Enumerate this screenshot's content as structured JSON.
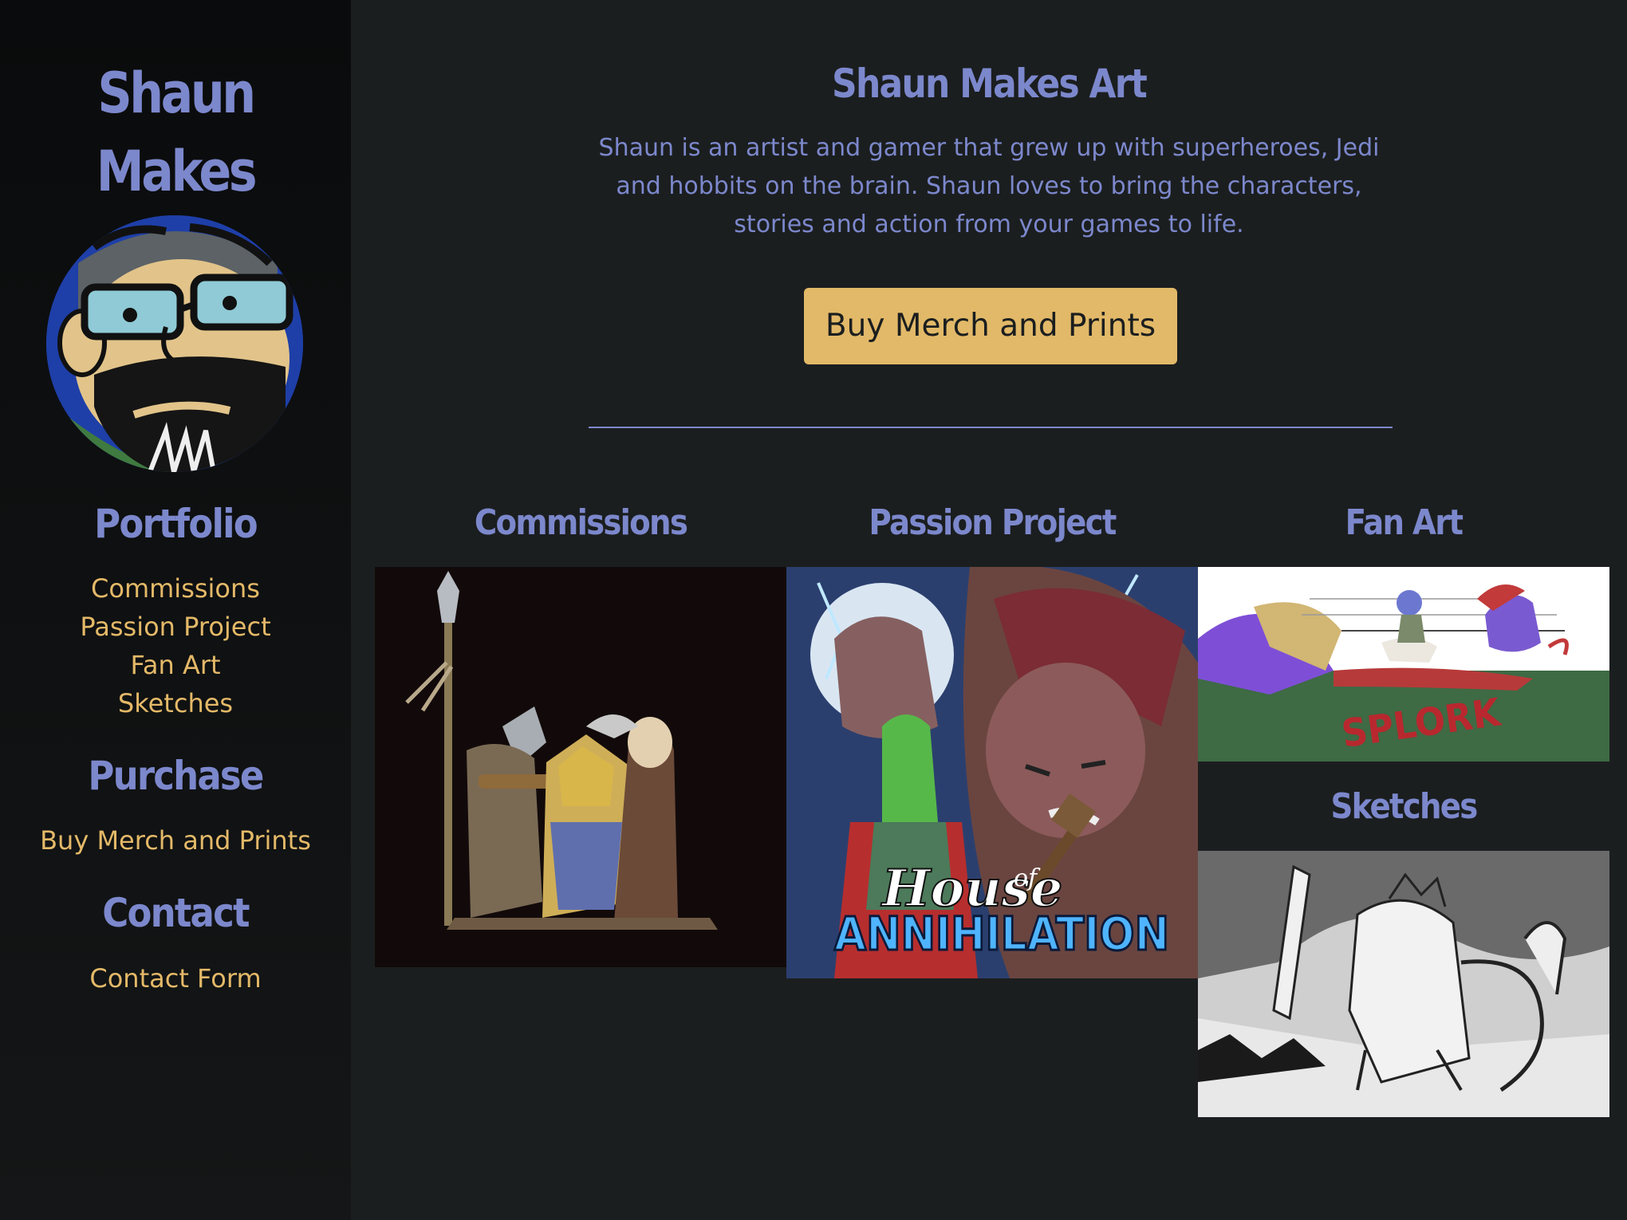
{
  "sidebar": {
    "brand_line1": "Shaun",
    "brand_line2": "Makes",
    "portfolio": {
      "heading": "Portfolio",
      "items": [
        "Commissions",
        "Passion Project",
        "Fan Art",
        "Sketches"
      ]
    },
    "purchase": {
      "heading": "Purchase",
      "items": [
        "Buy Merch and Prints"
      ]
    },
    "contact": {
      "heading": "Contact",
      "items": [
        "Contact Form"
      ]
    }
  },
  "main": {
    "title": "Shaun Makes Art",
    "intro": "Shaun is an artist and gamer that grew up with superheroes, Jedi and hobbits on the brain. Shaun loves to bring the characters, stories and action from your games to life.",
    "cta_label": "Buy Merch and Prints",
    "gallery": {
      "commissions_title": "Commissions",
      "passion_title": "Passion Project",
      "fanart_title": "Fan Art",
      "sketches_title": "Sketches",
      "passion_logo_line1": "House",
      "passion_logo_of": "of",
      "passion_logo_line2": "ANNIHILATION",
      "fanart_sfx": "SPLORK"
    }
  },
  "colors": {
    "accent_blue": "#7c88cc",
    "accent_gold": "#e2b968",
    "background": "#1b1e1f",
    "sidebar_bg": "#0c0d0e"
  },
  "icons": {
    "avatar": "cartoon-self-portrait"
  }
}
